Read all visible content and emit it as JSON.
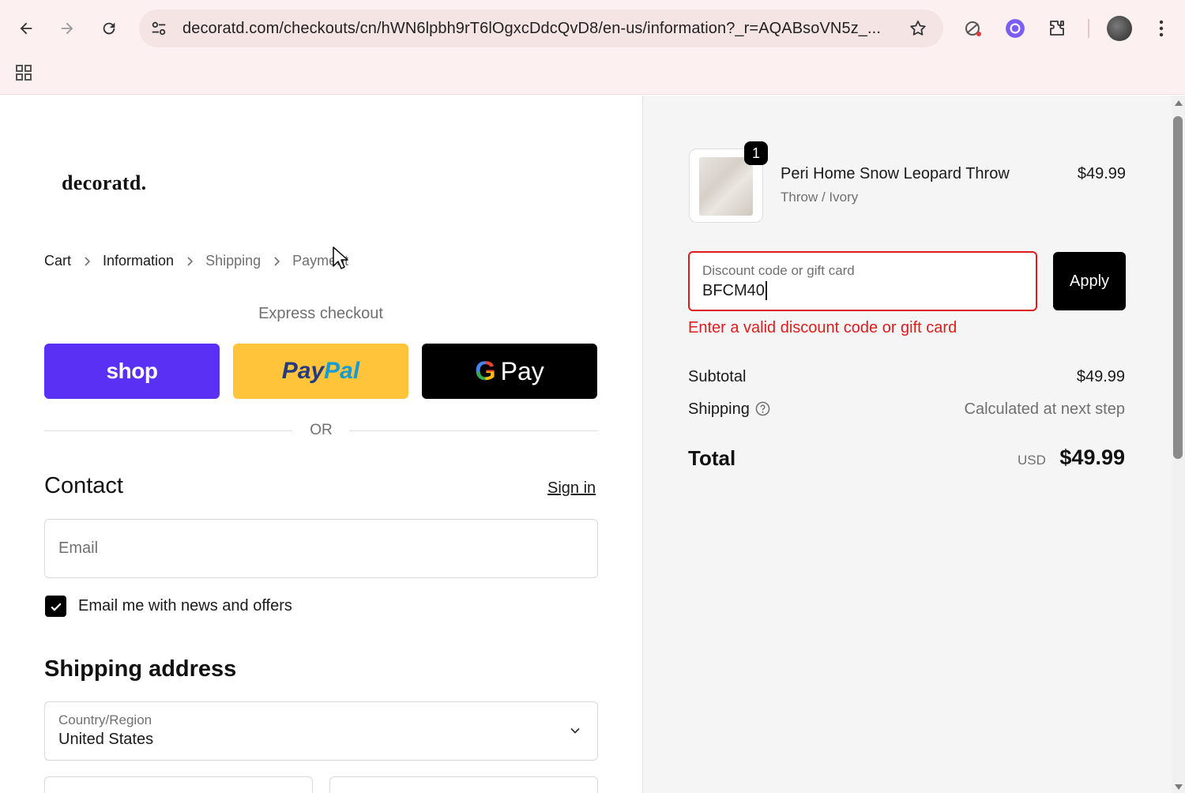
{
  "browser": {
    "url": "decoratd.com/checkouts/cn/hWN6lpbh9rT6lOgxcDdcQvD8/en-us/information?_r=AQABsoVN5z_..."
  },
  "store": {
    "logo": "decoratd."
  },
  "breadcrumbs": [
    "Cart",
    "Information",
    "Shipping",
    "Payment"
  ],
  "express": {
    "label": "Express checkout",
    "shop": "shop",
    "paypal_a": "Pay",
    "paypal_b": "Pal",
    "gpay_g": "G",
    "gpay": "Pay",
    "or": "OR"
  },
  "contact": {
    "heading": "Contact",
    "sign_in": "Sign in",
    "email_placeholder": "Email",
    "newsletter_label": "Email me with news and offers",
    "newsletter_checked": true
  },
  "shipping": {
    "heading": "Shipping address",
    "country_label": "Country/Region",
    "country_value": "United States"
  },
  "summary": {
    "item": {
      "quantity": "1",
      "name": "Peri Home Snow Leopard Throw",
      "variant": "Throw / Ivory",
      "price": "$49.99"
    },
    "discount": {
      "label": "Discount code or gift card",
      "value": "BFCM40",
      "apply": "Apply",
      "error": "Enter a valid discount code or gift card"
    },
    "subtotal_label": "Subtotal",
    "subtotal_value": "$49.99",
    "shipping_label": "Shipping",
    "shipping_value": "Calculated at next step",
    "total_label": "Total",
    "total_currency": "USD",
    "total_value": "$49.99"
  },
  "colors": {
    "shop_purple": "#5a31f4",
    "paypal_yellow": "#ffc439",
    "error_red": "#dd1d1d",
    "chrome_bg": "#fdf0f0"
  }
}
